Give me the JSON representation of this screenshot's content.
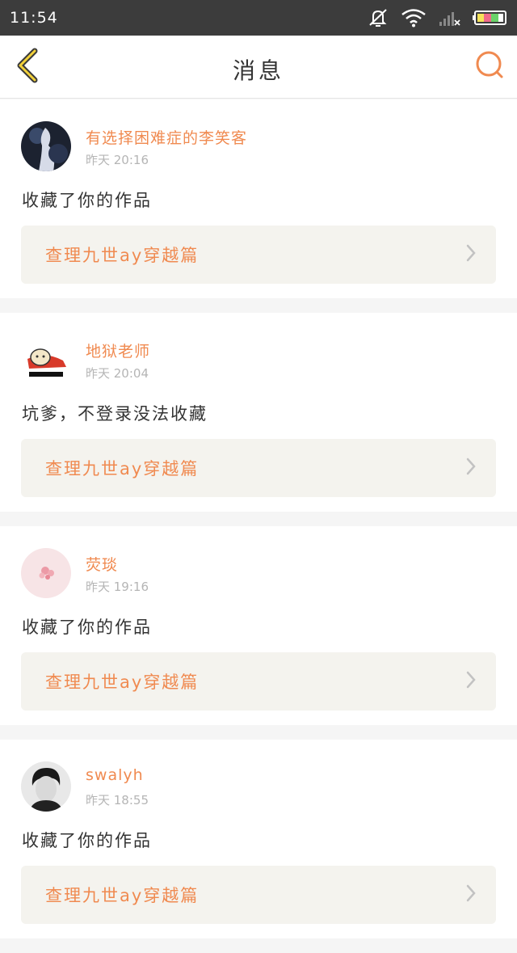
{
  "status_bar": {
    "time": "11:54",
    "icons": [
      "mute-icon",
      "wifi-icon",
      "signal-icon",
      "battery-icon"
    ]
  },
  "header": {
    "title": "消息",
    "back_icon": "chevron-left-icon",
    "search_icon": "search-icon"
  },
  "colors": {
    "accent": "#f08a50",
    "status_bar": "#3c3c3c",
    "card_link_bg": "#f4f3ee"
  },
  "messages": [
    {
      "user": "有选择困难症的李笑客",
      "time": "昨天 20:16",
      "text": "收藏了你的作品",
      "work": "查理九世ay穿越篇"
    },
    {
      "user": "地狱老师",
      "time": "昨天 20:04",
      "text": "坑爹，不登录没法收藏",
      "work": "查理九世ay穿越篇"
    },
    {
      "user": "荧琰",
      "time": "昨天 19:16",
      "text": "收藏了你的作品",
      "work": "查理九世ay穿越篇"
    },
    {
      "user": "swalyh",
      "time": "昨天 18:55",
      "text": "收藏了你的作品",
      "work": "查理九世ay穿越篇"
    }
  ]
}
